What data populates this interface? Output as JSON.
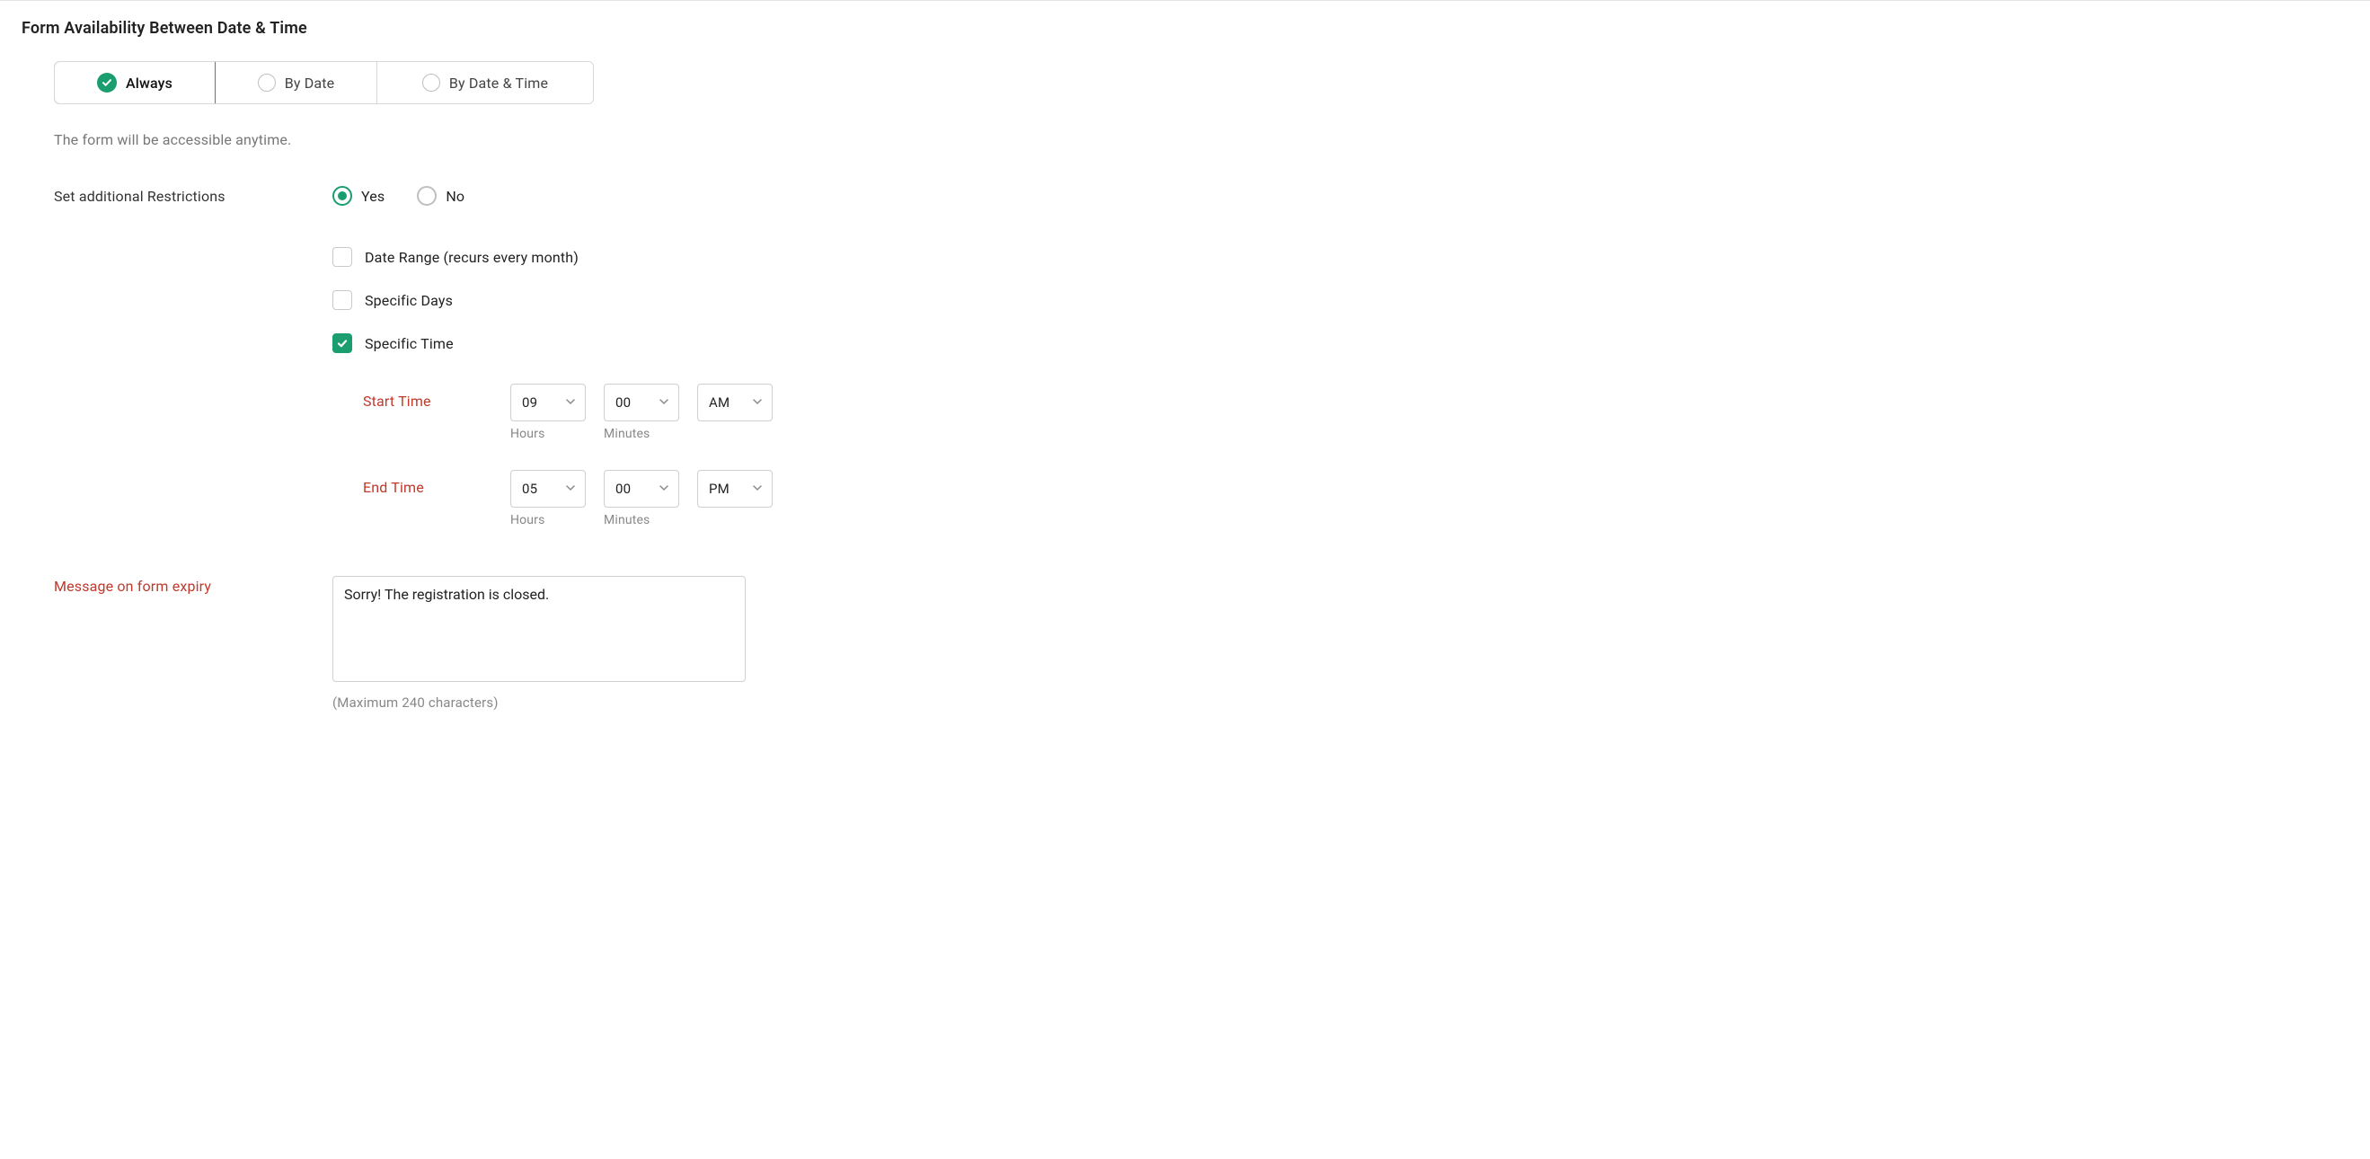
{
  "section_title": "Form Availability Between Date & Time",
  "tabs": {
    "always": "Always",
    "by_date": "By Date",
    "by_date_time": "By Date & Time"
  },
  "description": "The form will be accessible anytime.",
  "restrictions": {
    "label": "Set additional Restrictions",
    "yes": "Yes",
    "no": "No",
    "date_range": "Date Range (recurs every month)",
    "specific_days": "Specific Days",
    "specific_time": "Specific Time"
  },
  "time": {
    "start_label": "Start Time",
    "end_label": "End Time",
    "hours_label": "Hours",
    "minutes_label": "Minutes",
    "start": {
      "hour": "09",
      "minute": "00",
      "period": "AM"
    },
    "end": {
      "hour": "05",
      "minute": "00",
      "period": "PM"
    }
  },
  "expiry": {
    "label": "Message on form expiry",
    "message": "Sorry! The registration is closed.",
    "helper": "(Maximum 240 characters)"
  }
}
